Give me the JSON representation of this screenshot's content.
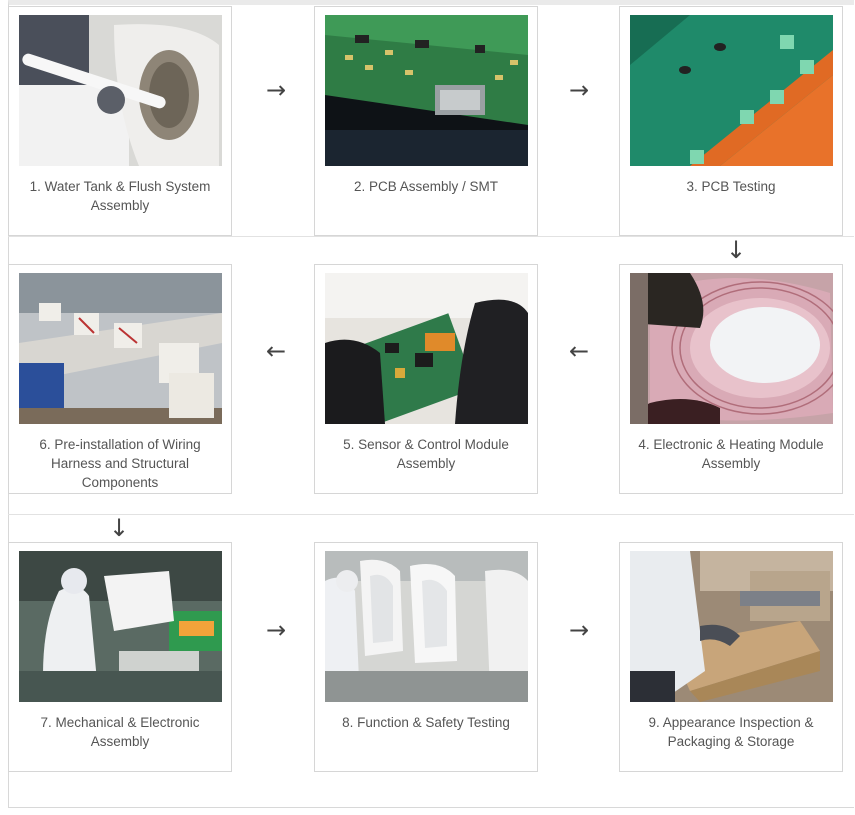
{
  "steps": [
    {
      "label": "1. Water Tank & Flush System Assembly",
      "photo": "worker-inserting-pipe-into-tank"
    },
    {
      "label": "2. PCB Assembly / SMT",
      "photo": "green-circuit-board-closeup"
    },
    {
      "label": "3. PCB Testing",
      "photo": "pcb-test-fixture"
    },
    {
      "label": "4. Electronic & Heating Module Assembly",
      "photo": "heating-wire-seat-ring"
    },
    {
      "label": "5. Sensor & Control Module Assembly",
      "photo": "gloved-hands-control-board"
    },
    {
      "label": "6. Pre-installation of Wiring Harness and Structural Components",
      "photo": "assembly-line-components"
    },
    {
      "label": "7. Mechanical & Electronic Assembly",
      "photo": "worker-assembling-toilet-unit"
    },
    {
      "label": "8. Function & Safety Testing",
      "photo": "toilet-seats-testing-line"
    },
    {
      "label": "9. Appearance Inspection & Packaging & Storage",
      "photo": "worker-packing-boxes"
    }
  ],
  "arrows": {
    "right": "→",
    "left": "←",
    "down": "↓"
  }
}
